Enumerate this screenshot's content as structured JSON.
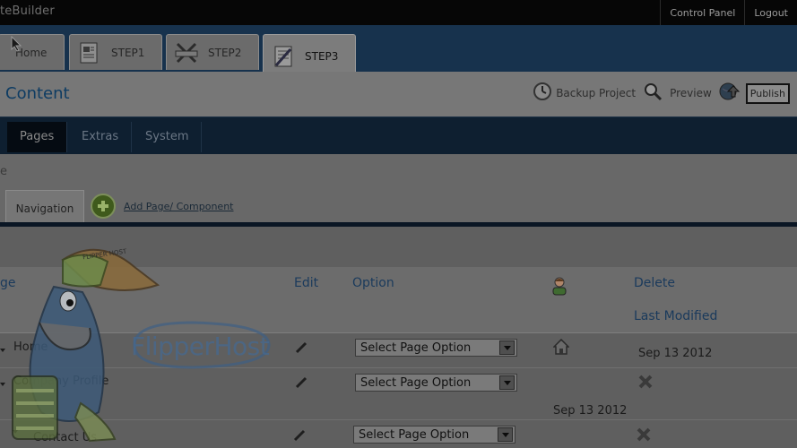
{
  "app": {
    "title_fragment": "teBuilder"
  },
  "top_links": [
    "Control Panel",
    "Logout"
  ],
  "steps": [
    {
      "label": "Home",
      "icon": "home-icon"
    },
    {
      "label": "STEP1",
      "icon": "document-icon"
    },
    {
      "label": "STEP2",
      "icon": "tools-icon"
    },
    {
      "label": "STEP3",
      "icon": "edit-document-icon"
    }
  ],
  "content": {
    "title": "Content",
    "actions": {
      "backup": "Backup Project",
      "preview": "Preview",
      "publish": "Publish"
    }
  },
  "nav": [
    "Pages",
    "Extras",
    "System"
  ],
  "sub": {
    "crumb_fragment": "e",
    "tab": "Navigation",
    "add_link": "Add Page/ Component"
  },
  "watermark": {
    "text": "FlipperHost",
    "cap_text": "FLIPPER HOST"
  },
  "table": {
    "headers": {
      "page": "ge",
      "edit": "Edit",
      "option": "Option",
      "delete": "Delete",
      "modified": "Last Modified"
    },
    "select_placeholder": "Select Page Option",
    "rows": [
      {
        "name": "Home",
        "option": "Select Page Option",
        "modified": "Sep 13 2012",
        "status_icon": "home-icon"
      },
      {
        "name": "Company Profile",
        "option": "Select Page Option",
        "modified": "Sep 13 2012",
        "status_icon": "delete-icon"
      },
      {
        "name": "Contact Us",
        "option": "Select Page Option",
        "modified": "",
        "status_icon": "delete-icon"
      }
    ]
  },
  "colors": {
    "step_bar": "#17324d",
    "nav_bar": "#0e1f30",
    "title_blue": "#0e3c63",
    "header_blue": "#1a3a5c"
  }
}
